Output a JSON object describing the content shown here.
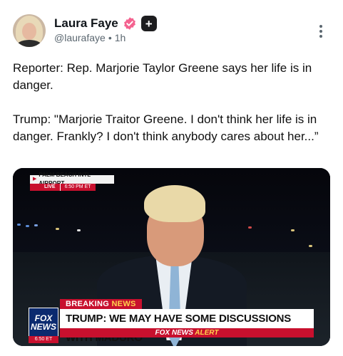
{
  "author": {
    "display_name": "Laura Faye",
    "handle": "@laurafaye",
    "separator": "•",
    "time_ago": "1h",
    "plus_badge": "+",
    "verified_color": "#f4628f"
  },
  "post": {
    "paragraphs": [
      "Reporter: Rep. Marjorie Taylor Greene says her life is in danger.",
      "Trump: \"Marjorie Traitor Greene. I don't think her life is in danger. Frankly? I don't think anybody cares about her...”"
    ]
  },
  "media": {
    "location": "PALM BEACH INTL AIRPORT",
    "live": "LIVE",
    "time": "6:50 PM ET",
    "breaking_prefix": "BREAKING",
    "breaking_suffix": "NEWS",
    "headline": "TRUMP: WE MAY HAVE SOME DISCUSSIONS WITH MADURO",
    "alert_prefix": "FOX NEWS",
    "alert_suffix": "ALERT",
    "logo_line1": "FOX",
    "logo_line2": "NEWS",
    "logo_time": "6:50 ET",
    "accent_red": "#c8102e",
    "logo_blue": "#0b2a6f"
  },
  "icons": {
    "verified": "verified-badge-icon",
    "plus": "plus-icon",
    "more": "more-vertical-icon"
  }
}
